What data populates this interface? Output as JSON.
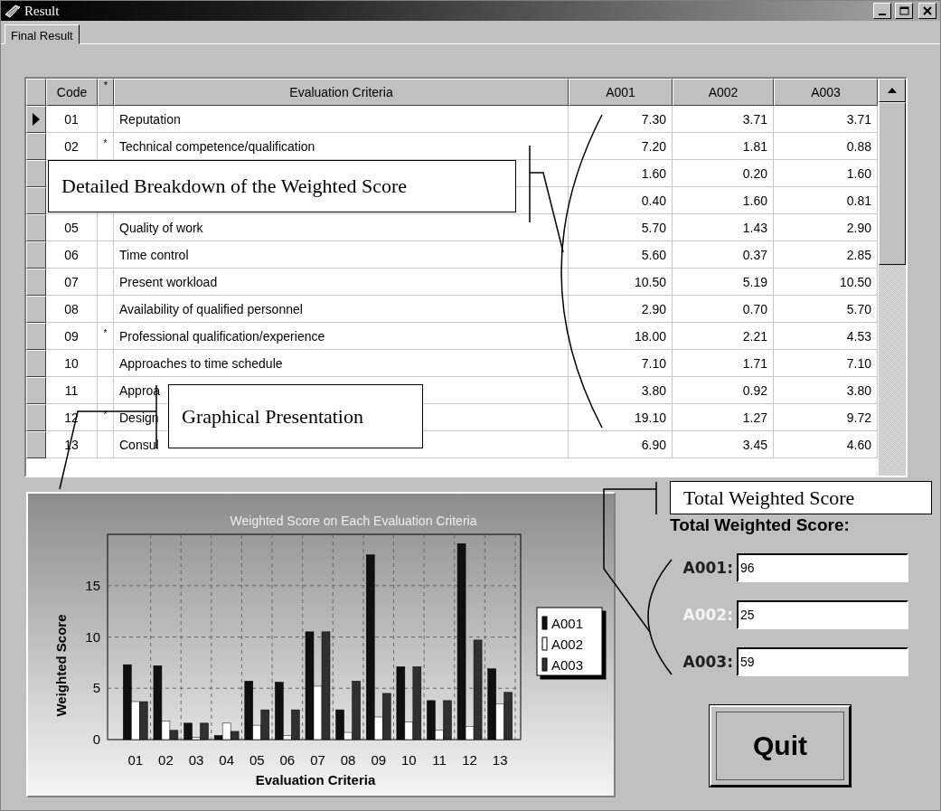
{
  "window": {
    "title": "Result"
  },
  "tabs": [
    {
      "label": "Final Result",
      "selected": true
    }
  ],
  "table": {
    "columns": [
      "Code",
      "*",
      "Evaluation Criteria",
      "A001",
      "A002",
      "A003"
    ],
    "rows": [
      {
        "code": "01",
        "mark": "",
        "criteria": "Reputation",
        "a001": "7.30",
        "a002": "3.71",
        "a003": "3.71",
        "selected": true
      },
      {
        "code": "02",
        "mark": "*",
        "criteria": "Technical competence/qualification",
        "a001": "7.20",
        "a002": "1.81",
        "a003": "0.88",
        "selected": false
      },
      {
        "a001": "1.60",
        "a002": "0.20",
        "a003": "1.60",
        "selected": false
      },
      {
        "a001": "0.40",
        "a002": "1.60",
        "a003": "0.81",
        "selected": false
      },
      {
        "code": "05",
        "mark": "",
        "criteria": "Quality of work",
        "a001": "5.70",
        "a002": "1.43",
        "a003": "2.90",
        "selected": false
      },
      {
        "code": "06",
        "mark": "",
        "criteria": "Time control",
        "a001": "5.60",
        "a002": "0.37",
        "a003": "2.85",
        "selected": false
      },
      {
        "code": "07",
        "mark": "",
        "criteria": "Present workload",
        "a001": "10.50",
        "a002": "5.19",
        "a003": "10.50",
        "selected": false
      },
      {
        "code": "08",
        "mark": "",
        "criteria": "Availability of qualified personnel",
        "a001": "2.90",
        "a002": "0.70",
        "a003": "5.70",
        "selected": false
      },
      {
        "code": "09",
        "mark": "*",
        "criteria": "Professional qualification/experience",
        "a001": "18.00",
        "a002": "2.21",
        "a003": "4.53",
        "selected": false
      },
      {
        "code": "10",
        "mark": "",
        "criteria": "Approaches to time schedule",
        "a001": "7.10",
        "a002": "1.71",
        "a003": "7.10",
        "selected": false
      },
      {
        "code": "11",
        "mark": "",
        "criteria": "Approa",
        "a001": "3.80",
        "a002": "0.92",
        "a003": "3.80",
        "selected": false
      },
      {
        "code": "12",
        "mark": "*",
        "criteria": "Design",
        "a001": "19.10",
        "a002": "1.27",
        "a003": "9.72",
        "selected": false
      },
      {
        "code": "13",
        "mark": "",
        "criteria": "Consul",
        "a001": "6.90",
        "a002": "3.45",
        "a003": "4.60",
        "selected": false
      }
    ]
  },
  "chart": {
    "chart_data": {
      "type": "bar",
      "title": "Weighted Score on Each Evaluation Criteria",
      "xlabel": "Evaluation Criteria",
      "ylabel": "Weighted Score",
      "categories": [
        "01",
        "02",
        "03",
        "04",
        "05",
        "06",
        "07",
        "08",
        "09",
        "10",
        "11",
        "12",
        "13"
      ],
      "series": [
        {
          "name": "A001",
          "color": "#101010",
          "values": [
            7.3,
            7.2,
            1.6,
            0.4,
            5.7,
            5.6,
            10.5,
            2.9,
            18.0,
            7.1,
            3.8,
            19.1,
            6.9
          ]
        },
        {
          "name": "A002",
          "color": "#ffffff",
          "values": [
            3.7,
            1.8,
            0.2,
            1.6,
            1.4,
            0.4,
            5.2,
            0.7,
            2.2,
            1.7,
            0.9,
            1.3,
            3.5
          ]
        },
        {
          "name": "A003",
          "color": "#303030",
          "values": [
            3.7,
            0.9,
            1.6,
            0.8,
            2.9,
            2.9,
            10.5,
            5.7,
            4.5,
            7.1,
            3.8,
            9.7,
            4.6
          ]
        }
      ],
      "ylim": [
        0,
        20
      ],
      "yticks": [
        0,
        5,
        10,
        15
      ],
      "grid": true,
      "legend": true
    }
  },
  "totals": {
    "label": "Total Weighted Score:",
    "scores": [
      {
        "label": "A001:",
        "value": "96",
        "disabled": false
      },
      {
        "label": "A002:",
        "value": "25",
        "disabled": true
      },
      {
        "label": "A003:",
        "value": "59",
        "disabled": false
      }
    ]
  },
  "quit_button": {
    "label": "Quit"
  },
  "callouts": [
    "Detailed Breakdown of the Weighted Score",
    "Graphical Presentation",
    "Total Weighted Score"
  ]
}
